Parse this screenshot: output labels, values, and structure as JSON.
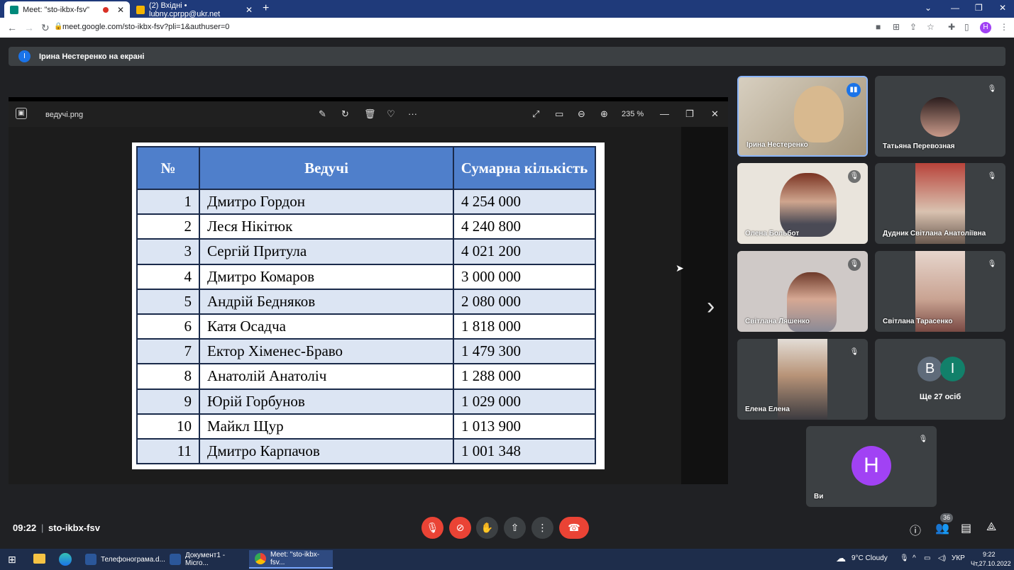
{
  "browser": {
    "tabs": [
      {
        "title": "Meet: \"sto-ikbx-fsv\"",
        "active": true
      },
      {
        "title": "(2) Вхідні • lubny.cprpp@ukr.net",
        "active": false
      }
    ],
    "url": "meet.google.com/sto-ikbx-fsv?pli=1&authuser=0",
    "profile_initial": "H"
  },
  "banner": {
    "avatar_initial": "І",
    "text": "Ірина Нестеренко на екрані"
  },
  "viewer": {
    "file_name": "ведучі.png",
    "zoom": "235 %"
  },
  "table": {
    "headers": [
      "№",
      "Ведучі",
      "Сумарна кількість"
    ],
    "rows": [
      {
        "num": "1",
        "name": "Дмитро Гордон",
        "sum": "4 254 000"
      },
      {
        "num": "2",
        "name": "Леся Нікітюк",
        "sum": "4 240 800"
      },
      {
        "num": "3",
        "name": "Сергій Притула",
        "sum": "4 021 200"
      },
      {
        "num": "4",
        "name": "Дмитро Комаров",
        "sum": "3 000 000"
      },
      {
        "num": "5",
        "name": "Андрій Бедняков",
        "sum": "2 080 000"
      },
      {
        "num": "6",
        "name": "Катя Осадча",
        "sum": "1 818 000"
      },
      {
        "num": "7",
        "name": "Ектор Хіменес-Браво",
        "sum": "1 479 300"
      },
      {
        "num": "8",
        "name": "Анатолій Анатоліч",
        "sum": "1 288 000"
      },
      {
        "num": "9",
        "name": "Юрій Горбунов",
        "sum": "1 029 000"
      },
      {
        "num": "10",
        "name": "Майкл Щур",
        "sum": "1 013 900"
      },
      {
        "num": "11",
        "name": "Дмитро Карпачов",
        "sum": "1 001 348"
      }
    ]
  },
  "participants": [
    {
      "name": "Ірина Нестеренко"
    },
    {
      "name": "Татьяна Перевозная"
    },
    {
      "name": "Олена Больбот"
    },
    {
      "name": "Дудник Світлана Анатоліївна"
    },
    {
      "name": "Світлана Ляшенко"
    },
    {
      "name": "Світлана Тарасенко"
    },
    {
      "name": "Елена Елена"
    },
    {
      "name": "Ще 27 осіб",
      "initials": [
        "В",
        "І"
      ]
    },
    {
      "name": "Ви",
      "initial": "Н"
    }
  ],
  "bottom": {
    "time": "09:22",
    "meeting_id": "sto-ikbx-fsv",
    "people_count": "36"
  },
  "taskbar": {
    "items": [
      "Телефонограма.d...",
      "Документ1 - Micro...",
      "Meet: \"sto-ikbx-fsv..."
    ],
    "weather": "9°C  Cloudy",
    "language": "УКР",
    "clock_time": "9:22",
    "clock_date": "Чт,27.10.2022"
  },
  "colors": {
    "meet_bg": "#202124",
    "tile_bg": "#3c4043",
    "header_blue": "#4f7fcb",
    "row_alt": "#dce5f3",
    "danger": "#ea4335",
    "accent": "#1a73e8"
  }
}
